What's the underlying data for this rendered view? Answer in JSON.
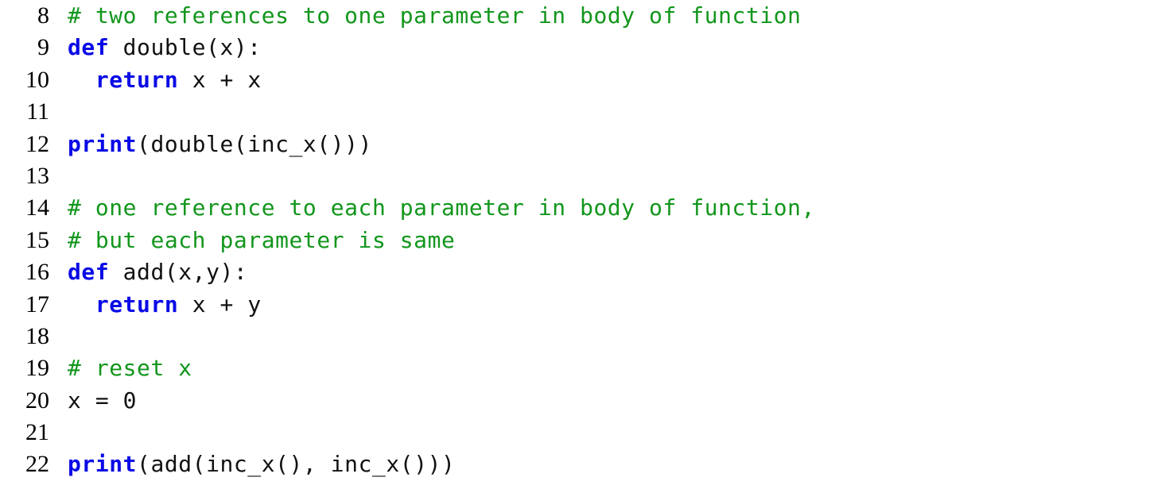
{
  "colors": {
    "background": "#ffffff",
    "keyword": "#0a0ae6",
    "comment": "#12961c",
    "plain": "#111111",
    "line_number": "#000000"
  },
  "listing": {
    "language": "Python",
    "first_line_number": 8,
    "last_line_number": 22,
    "lines": [
      {
        "number": "8",
        "text": "# two references to one parameter in body of function",
        "tokens": [
          {
            "kind": "comment",
            "text": "# two references to one parameter in body of function"
          }
        ]
      },
      {
        "number": "9",
        "text": "def double(x):",
        "tokens": [
          {
            "kind": "keyword",
            "text": "def"
          },
          {
            "kind": "plain",
            "text": " double(x):"
          }
        ]
      },
      {
        "number": "10",
        "text": "    return x + x",
        "tokens": [
          {
            "kind": "plain",
            "text": "  "
          },
          {
            "kind": "keyword",
            "text": "return"
          },
          {
            "kind": "plain",
            "text": " x + x"
          }
        ]
      },
      {
        "number": "11",
        "text": "",
        "tokens": []
      },
      {
        "number": "12",
        "text": "print(double(inc_x()))",
        "tokens": [
          {
            "kind": "keyword",
            "text": "print"
          },
          {
            "kind": "plain",
            "text": "(double(inc_x()))"
          }
        ]
      },
      {
        "number": "13",
        "text": "",
        "tokens": []
      },
      {
        "number": "14",
        "text": "# one reference to each parameter in body of function,",
        "tokens": [
          {
            "kind": "comment",
            "text": "# one reference to each parameter in body of function,"
          }
        ]
      },
      {
        "number": "15",
        "text": "# but each parameter is same",
        "tokens": [
          {
            "kind": "comment",
            "text": "# but each parameter is same"
          }
        ]
      },
      {
        "number": "16",
        "text": "def add(x,y):",
        "tokens": [
          {
            "kind": "keyword",
            "text": "def"
          },
          {
            "kind": "plain",
            "text": " add(x,y):"
          }
        ]
      },
      {
        "number": "17",
        "text": "    return x + y",
        "tokens": [
          {
            "kind": "plain",
            "text": "  "
          },
          {
            "kind": "keyword",
            "text": "return"
          },
          {
            "kind": "plain",
            "text": " x + y"
          }
        ]
      },
      {
        "number": "18",
        "text": "",
        "tokens": []
      },
      {
        "number": "19",
        "text": "# reset x",
        "tokens": [
          {
            "kind": "comment",
            "text": "# reset x"
          }
        ]
      },
      {
        "number": "20",
        "text": "x = 0",
        "tokens": [
          {
            "kind": "plain",
            "text": "x = 0"
          }
        ]
      },
      {
        "number": "21",
        "text": "",
        "tokens": []
      },
      {
        "number": "22",
        "text": "print(add(inc_x(), inc_x()))",
        "tokens": [
          {
            "kind": "keyword",
            "text": "print"
          },
          {
            "kind": "plain",
            "text": "(add(inc_x(), inc_x()))"
          }
        ]
      }
    ]
  }
}
